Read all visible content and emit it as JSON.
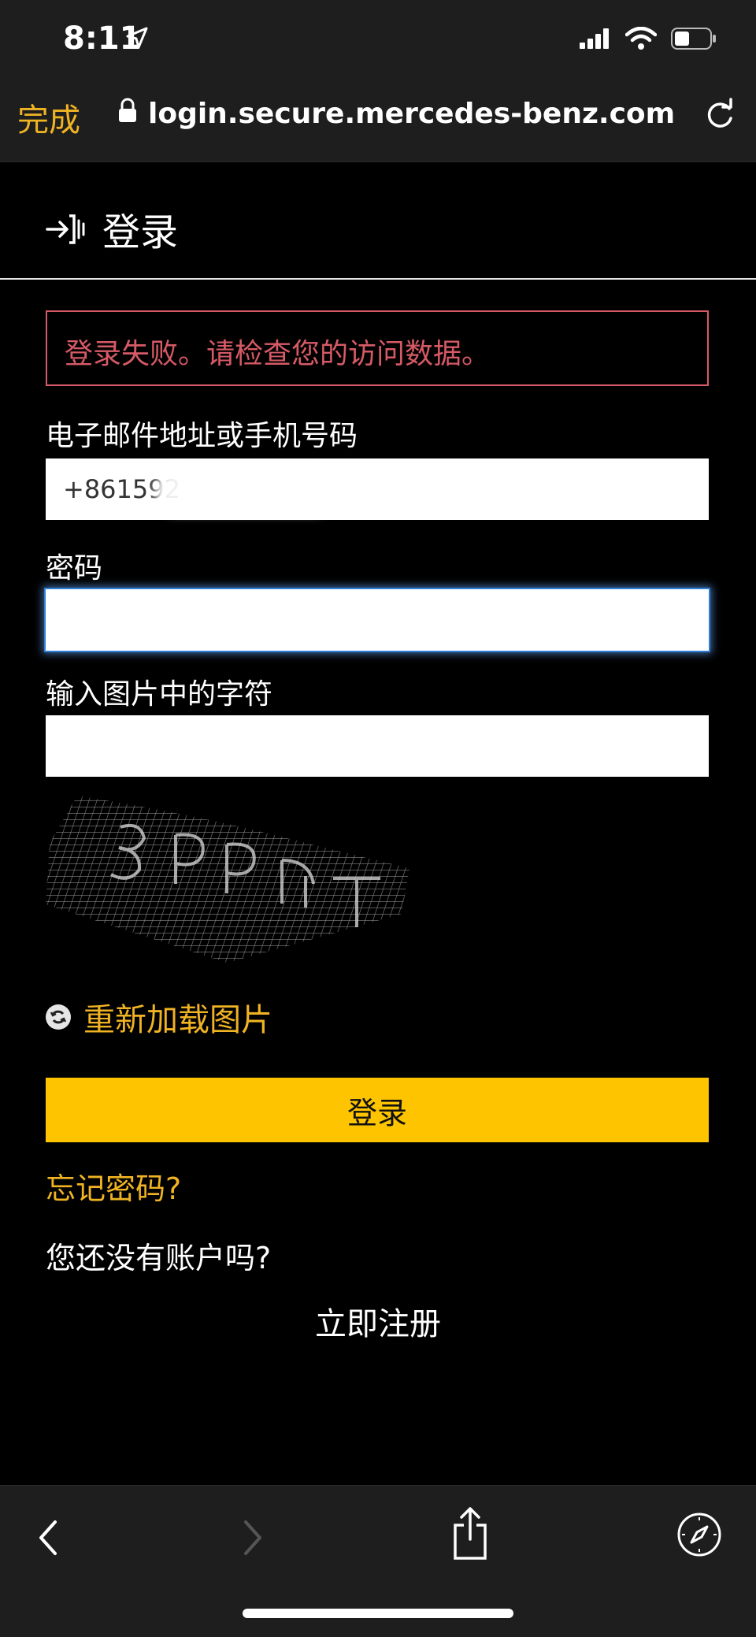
{
  "status": {
    "time": "8:11"
  },
  "browser": {
    "done_label": "完成",
    "url": "login.secure.mercedes-benz.com"
  },
  "page": {
    "title": "登录",
    "error_message": "登录失败。请检查您的访问数据。",
    "email_label": "电子邮件地址或手机号码",
    "email_value": "+861592",
    "password_label": "密码",
    "captcha_label": "输入图片中的字符",
    "reload_image_label": "重新加载图片",
    "login_button": "登录",
    "forgot_password": "忘记密码?",
    "no_account": "您还没有账户吗?",
    "register": "立即注册"
  },
  "colors": {
    "accent": "#f0b323",
    "button": "#ffc400",
    "error": "#d65a66",
    "bars_bg": "#1e1e1e"
  }
}
